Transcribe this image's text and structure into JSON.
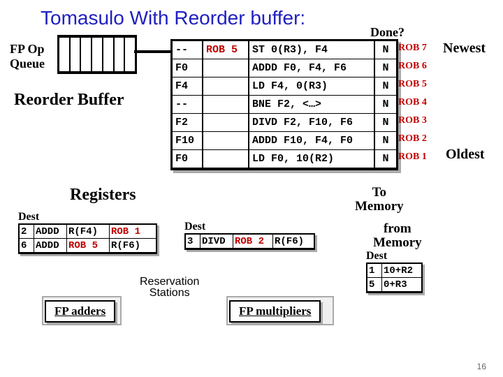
{
  "title": "Tomasulo With Reorder buffer:",
  "labels": {
    "fp_op_queue": "FP Op\nQueue",
    "reorder_buffer": "Reorder Buffer",
    "done": "Done?",
    "newest": "Newest",
    "oldest": "Oldest",
    "registers": "Registers",
    "to_memory": "To\nMemory",
    "from_memory": "from\nMemory",
    "dest": "Dest",
    "reservation_stations": "Reservation\nStations",
    "fp_adders": "FP adders",
    "fp_multipliers": "FP multipliers"
  },
  "rob": [
    {
      "dest": "--",
      "tag": "ROB 5",
      "instr": "ST 0(R3), F4",
      "done": "N",
      "name": "ROB 7"
    },
    {
      "dest": "F0",
      "tag": "",
      "instr": "ADDD F0, F4, F6",
      "done": "N",
      "name": "ROB 6"
    },
    {
      "dest": "F4",
      "tag": "",
      "instr": "LD F4, 0(R3)",
      "done": "N",
      "name": "ROB 5"
    },
    {
      "dest": "--",
      "tag": "",
      "instr": "BNE F2, <…>",
      "done": "N",
      "name": "ROB 4"
    },
    {
      "dest": "F2",
      "tag": "",
      "instr": "DIVD F2, F10, F6",
      "done": "N",
      "name": "ROB 3"
    },
    {
      "dest": "F10",
      "tag": "",
      "instr": "ADDD F10, F4, F0",
      "done": "N",
      "name": "ROB 2"
    },
    {
      "dest": "F0",
      "tag": "",
      "instr": "LD F0, 10(R2)",
      "done": "N",
      "name": "ROB 1"
    }
  ],
  "rs_adders": [
    {
      "n": "2",
      "op": "ADDD",
      "src1": "R(F4)",
      "src2": "ROB 1",
      "src2_red": true
    },
    {
      "n": "6",
      "op": "ADDD",
      "src1": "ROB 5",
      "src1_red": true,
      "src2": "R(F6)"
    }
  ],
  "rs_mult": [
    {
      "n": "3",
      "op": "DIVD",
      "src1": "ROB 2",
      "src1_red": true,
      "src2": "R(F6)"
    }
  ],
  "rs_mem": [
    {
      "n": "1",
      "v": "10+R2"
    },
    {
      "n": "5",
      "v": "0+R3"
    }
  ],
  "page": "16"
}
